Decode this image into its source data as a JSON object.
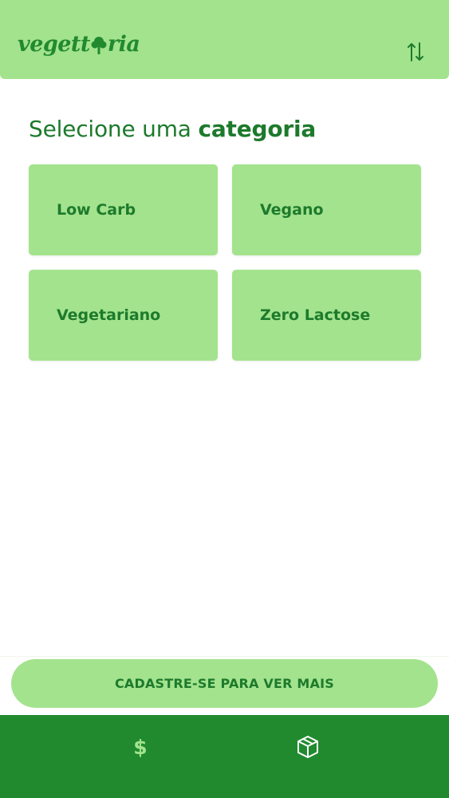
{
  "header": {
    "logo_text_before": "vegett",
    "logo_text_after": "ria",
    "logo_icon": "tree-icon",
    "sort_icon": "sort-arrows-icon"
  },
  "main": {
    "title_prefix": "Selecione uma",
    "title_emphasis": "categoria",
    "categories": [
      {
        "label": "Low Carb"
      },
      {
        "label": "Vegano"
      },
      {
        "label": "Vegetariano"
      },
      {
        "label": "Zero Lactose"
      }
    ]
  },
  "cta": {
    "signup_label": "CADASTRE-SE PARA VER MAIS"
  },
  "bottom_nav": {
    "items": [
      {
        "icon": "dollar-icon",
        "glyph": "$"
      },
      {
        "icon": "box-icon"
      }
    ]
  },
  "colors": {
    "light_green": "#a3e38d",
    "dark_green": "#218a2f",
    "text_green": "#1d7a2c",
    "background": "#ffffff"
  }
}
